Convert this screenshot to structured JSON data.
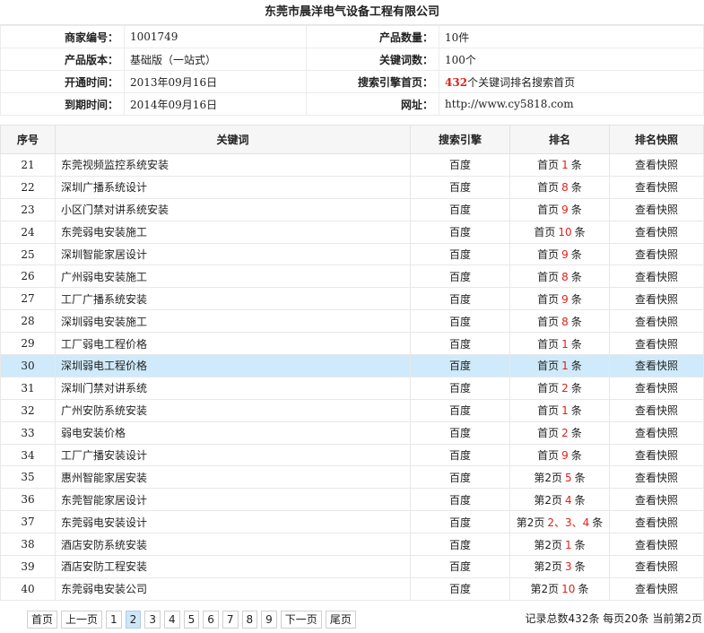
{
  "company": "东莞市晨洋电气设备工程有限公司",
  "info": {
    "merchant_id_label": "商家编号：",
    "merchant_id": "1001749",
    "product_count_label": "产品数量：",
    "product_count": "10件",
    "edition_label": "产品版本：",
    "edition": "基础版（一站式）",
    "keyword_count_label": "关键词数：",
    "keyword_count": "100个",
    "open_label": "开通时间：",
    "open_date": "2013年09月16日",
    "search_home_label": "搜索引擎首页：",
    "search_home_num": "432",
    "search_home_text": "个关键词排名搜索首页",
    "expire_label": "到期时间：",
    "expire_date": "2014年09月16日",
    "url_label": "网址：",
    "url": "http://www.cy5818.com"
  },
  "table": {
    "headers": [
      "序号",
      "关键词",
      "搜索引擎",
      "排名",
      "排名快照"
    ],
    "rows": [
      {
        "idx": "21",
        "kw": "东莞视频监控系统安装",
        "se": "百度",
        "page": "首页",
        "num": "1",
        "unit": "条",
        "snap": "查看快照"
      },
      {
        "idx": "22",
        "kw": "深圳广播系统设计",
        "se": "百度",
        "page": "首页",
        "num": "8",
        "unit": "条",
        "snap": "查看快照"
      },
      {
        "idx": "23",
        "kw": "小区门禁对讲系统安装",
        "se": "百度",
        "page": "首页",
        "num": "9",
        "unit": "条",
        "snap": "查看快照"
      },
      {
        "idx": "24",
        "kw": "东莞弱电安装施工",
        "se": "百度",
        "page": "首页",
        "num": "10",
        "unit": "条",
        "snap": "查看快照"
      },
      {
        "idx": "25",
        "kw": "深圳智能家居设计",
        "se": "百度",
        "page": "首页",
        "num": "9",
        "unit": "条",
        "snap": "查看快照"
      },
      {
        "idx": "26",
        "kw": "广州弱电安装施工",
        "se": "百度",
        "page": "首页",
        "num": "8",
        "unit": "条",
        "snap": "查看快照"
      },
      {
        "idx": "27",
        "kw": "工厂广播系统安装",
        "se": "百度",
        "page": "首页",
        "num": "9",
        "unit": "条",
        "snap": "查看快照"
      },
      {
        "idx": "28",
        "kw": "深圳弱电安装施工",
        "se": "百度",
        "page": "首页",
        "num": "8",
        "unit": "条",
        "snap": "查看快照"
      },
      {
        "idx": "29",
        "kw": "工厂弱电工程价格",
        "se": "百度",
        "page": "首页",
        "num": "1",
        "unit": "条",
        "snap": "查看快照"
      },
      {
        "idx": "30",
        "kw": "深圳弱电工程价格",
        "se": "百度",
        "page": "首页",
        "num": "1",
        "unit": "条",
        "snap": "查看快照"
      },
      {
        "idx": "31",
        "kw": "深圳门禁对讲系统",
        "se": "百度",
        "page": "首页",
        "num": "2",
        "unit": "条",
        "snap": "查看快照"
      },
      {
        "idx": "32",
        "kw": "广州安防系统安装",
        "se": "百度",
        "page": "首页",
        "num": "1",
        "unit": "条",
        "snap": "查看快照"
      },
      {
        "idx": "33",
        "kw": "弱电安装价格",
        "se": "百度",
        "page": "首页",
        "num": "2",
        "unit": "条",
        "snap": "查看快照"
      },
      {
        "idx": "34",
        "kw": "工厂广播安装设计",
        "se": "百度",
        "page": "首页",
        "num": "9",
        "unit": "条",
        "snap": "查看快照"
      },
      {
        "idx": "35",
        "kw": "惠州智能家居安装",
        "se": "百度",
        "page": "第2页",
        "num": "5",
        "unit": "条",
        "snap": "查看快照"
      },
      {
        "idx": "36",
        "kw": "东莞智能家居设计",
        "se": "百度",
        "page": "第2页",
        "num": "4",
        "unit": "条",
        "snap": "查看快照"
      },
      {
        "idx": "37",
        "kw": "东莞弱电安装设计",
        "se": "百度",
        "page": "第2页",
        "num": "2、3、4",
        "unit": "条",
        "snap": "查看快照"
      },
      {
        "idx": "38",
        "kw": "酒店安防系统安装",
        "se": "百度",
        "page": "第2页",
        "num": "1",
        "unit": "条",
        "snap": "查看快照"
      },
      {
        "idx": "39",
        "kw": "酒店安防工程安装",
        "se": "百度",
        "page": "第2页",
        "num": "3",
        "unit": "条",
        "snap": "查看快照"
      },
      {
        "idx": "40",
        "kw": "东莞弱电安装公司",
        "se": "百度",
        "page": "第2页",
        "num": "10",
        "unit": "条",
        "snap": "查看快照"
      }
    ],
    "highlight_row": "30"
  },
  "pager": {
    "first": "首页",
    "prev": "上一页",
    "pages": [
      "1",
      "2",
      "3",
      "4",
      "5",
      "6",
      "7",
      "8",
      "9"
    ],
    "current": "2",
    "next": "下一页",
    "last": "尾页",
    "stat": "记录总数432条 每页20条 当前第2页"
  },
  "colors": {
    "accent_red": "#e0201a",
    "highlight": "#cfeafa"
  }
}
